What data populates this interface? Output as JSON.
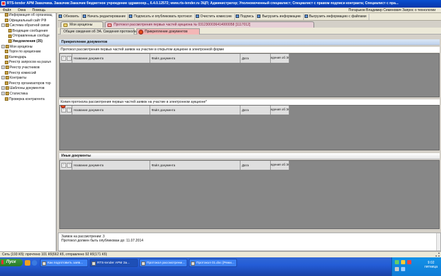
{
  "window": {
    "title": "RTS-tender АРМ Заказчика. Заказчик:Заказчик бюджетное учреждение здравоохр.., 6.4.0.12572; www.rts-tender.ru ЭЦП; Администратор; Уполномоченный специалист; Специалист с правом подписи контракта; Специалист с пра..."
  },
  "menu": {
    "items": [
      "Файл",
      "Окна",
      "Помощь"
    ],
    "user": "Погарьков Владимир Семенович  Запрос о технологии"
  },
  "sidebar": {
    "items": [
      {
        "label": "Информация об организац",
        "toggle": "",
        "bold": false,
        "indent": 1
      },
      {
        "label": "Официальный сайт РФ",
        "toggle": "",
        "bold": false,
        "indent": 1
      },
      {
        "label": "Система обратной связи",
        "toggle": "−",
        "bold": false,
        "indent": 0
      },
      {
        "label": "Входящие сообщения",
        "toggle": "",
        "bold": false,
        "indent": 2
      },
      {
        "label": "Отправленные сообще",
        "toggle": "",
        "bold": false,
        "indent": 2
      },
      {
        "label": "Уведомления (35)",
        "toggle": "",
        "bold": true,
        "indent": 2
      },
      {
        "label": "Мои аукционы",
        "toggle": "+",
        "bold": false,
        "indent": 0
      },
      {
        "label": "Торги по аукционам",
        "toggle": "",
        "bold": false,
        "indent": 1
      },
      {
        "label": "Календарь",
        "toggle": "",
        "bold": false,
        "indent": 1
      },
      {
        "label": "Реестр запросов на разъя",
        "toggle": "",
        "bold": false,
        "indent": 1
      },
      {
        "label": "Реестр участников",
        "toggle": "+",
        "bold": false,
        "indent": 0
      },
      {
        "label": "Реестр комиссий",
        "toggle": "",
        "bold": false,
        "indent": 1
      },
      {
        "label": "Контракты",
        "toggle": "+",
        "bold": false,
        "indent": 0
      },
      {
        "label": "Реестр организаторов тор",
        "toggle": "",
        "bold": false,
        "indent": 1
      },
      {
        "label": "Шаблоны документов",
        "toggle": "+",
        "bold": false,
        "indent": 0
      },
      {
        "label": "Статистика",
        "toggle": "+",
        "bold": false,
        "indent": 0
      },
      {
        "label": "Проверка контрагента",
        "toggle": "",
        "bold": false,
        "indent": 1
      }
    ]
  },
  "toolbar": {
    "buttons": [
      "Обновить",
      "Начать редактирование",
      "Подписать и опубликовать протокол",
      "Очистить комиссию",
      "Подпись",
      "Выгрузить информацию",
      "Выгрузить информацию с файлами"
    ]
  },
  "doc_tabs": {
    "auctions": "Мои аукционы",
    "protocol": "Протокол рассмотрения первых частей аукциона № 0312300036414000058 [1117012]"
  },
  "sub_tabs": {
    "general": "Общие сведения об ЭА. Сведения протокола",
    "attachments": "Прикрепление документов"
  },
  "content": {
    "section_title": "Прикрепление документов",
    "section1_label": "Протокол рассмотрения первых частей заявок на участие в открытом аукционе в электронной форме",
    "section2_label": "Копия протокола рассмотрения первых частей заявок на участие в электронном аукционе*",
    "section3_title": "Иные документы",
    "columns": {
      "name": "Название документа",
      "file": "Файл документа",
      "date": "Дата",
      "sign": "Сведения об ЭЦП"
    }
  },
  "status": {
    "line1": "Заявок на рассмотрении: 3",
    "line2": "Протокол должен быть опубликован до: 11.07.2014"
  },
  "network": {
    "text": "Сеть (193 Кб): прочтено 101 Кб(662 Кб, отправлено 92 Кб(171 Кб)"
  },
  "taskbar": {
    "start": "Пуск",
    "tasks": [
      "Как подготовить заяв...",
      "RTS-tender АРМ За...",
      "Протокол рассмотрени...",
      "Протокол 01.doc [Режи..."
    ],
    "time": "9:02",
    "day": "пятница"
  }
}
